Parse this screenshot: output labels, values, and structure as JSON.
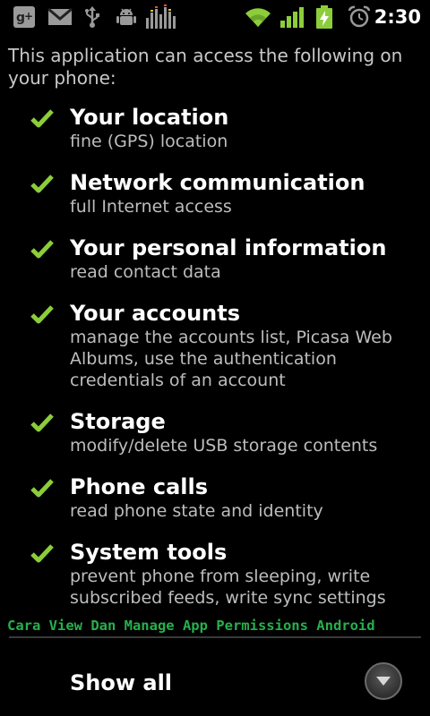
{
  "status_bar": {
    "time": "2:30",
    "icons": [
      "google-plus-icon",
      "gmail-icon",
      "usb-icon",
      "android-debug-icon",
      "equalizer-icon",
      "wifi-icon",
      "signal-icon",
      "battery-charging-icon",
      "alarm-icon"
    ]
  },
  "intro": "This application can access the following on your phone:",
  "permissions": [
    {
      "title": "Your location",
      "desc": "fine (GPS) location"
    },
    {
      "title": "Network communication",
      "desc": "full Internet access"
    },
    {
      "title": "Your personal information",
      "desc": "read contact data"
    },
    {
      "title": "Your accounts",
      "desc": "manage the accounts list, Picasa Web Albums, use the authentication credentials of an account"
    },
    {
      "title": "Storage",
      "desc": "modify/delete USB storage contents"
    },
    {
      "title": "Phone calls",
      "desc": "read phone state and identity"
    },
    {
      "title": "System tools",
      "desc": "prevent phone from sleeping, write subscribed feeds, write sync settings"
    }
  ],
  "watermark": "Cara View Dan Manage App Permissions Android",
  "show_all": {
    "label": "Show all"
  },
  "colors": {
    "check": "#8ccd3a",
    "watermark": "#27b04d",
    "wifi": "#8ccd3a",
    "signal": "#8ccd3a",
    "battery": "#8ccd3a"
  }
}
